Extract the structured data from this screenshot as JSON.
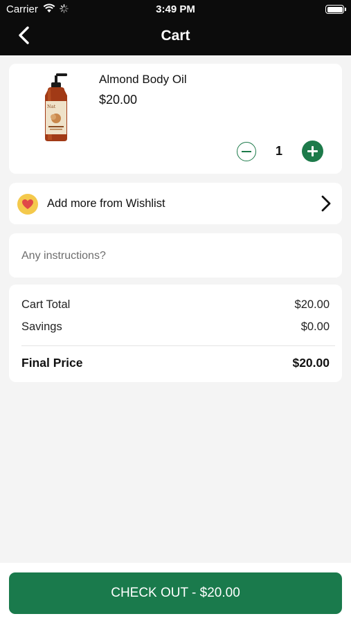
{
  "status_bar": {
    "carrier": "Carrier",
    "time": "3:49 PM",
    "wifi_icon": "wifi-icon",
    "activity_icon": "activity-spinner-icon",
    "battery_icon": "battery-icon"
  },
  "header": {
    "title": "Cart",
    "back_icon": "chevron-left-icon"
  },
  "cart_items": [
    {
      "name": "Almond Body Oil",
      "price": "$20.00",
      "quantity": "1",
      "image": "almond-body-oil-bottle"
    }
  ],
  "wishlist": {
    "label": "Add more from Wishlist",
    "icon": "heart-icon",
    "chevron_icon": "chevron-right-icon"
  },
  "instructions": {
    "placeholder": "Any instructions?",
    "value": ""
  },
  "summary": {
    "cart_total_label": "Cart Total",
    "cart_total_value": "$20.00",
    "savings_label": "Savings",
    "savings_value": "$0.00",
    "final_price_label": "Final Price",
    "final_price_value": "$20.00"
  },
  "checkout": {
    "label": "CHECK OUT - $20.00"
  },
  "colors": {
    "accent_green": "#1a7a4c",
    "header_black": "#0c0c0c",
    "background": "#f4f4f4",
    "heart_badge": "#f4c94c",
    "heart_red": "#e04848"
  }
}
